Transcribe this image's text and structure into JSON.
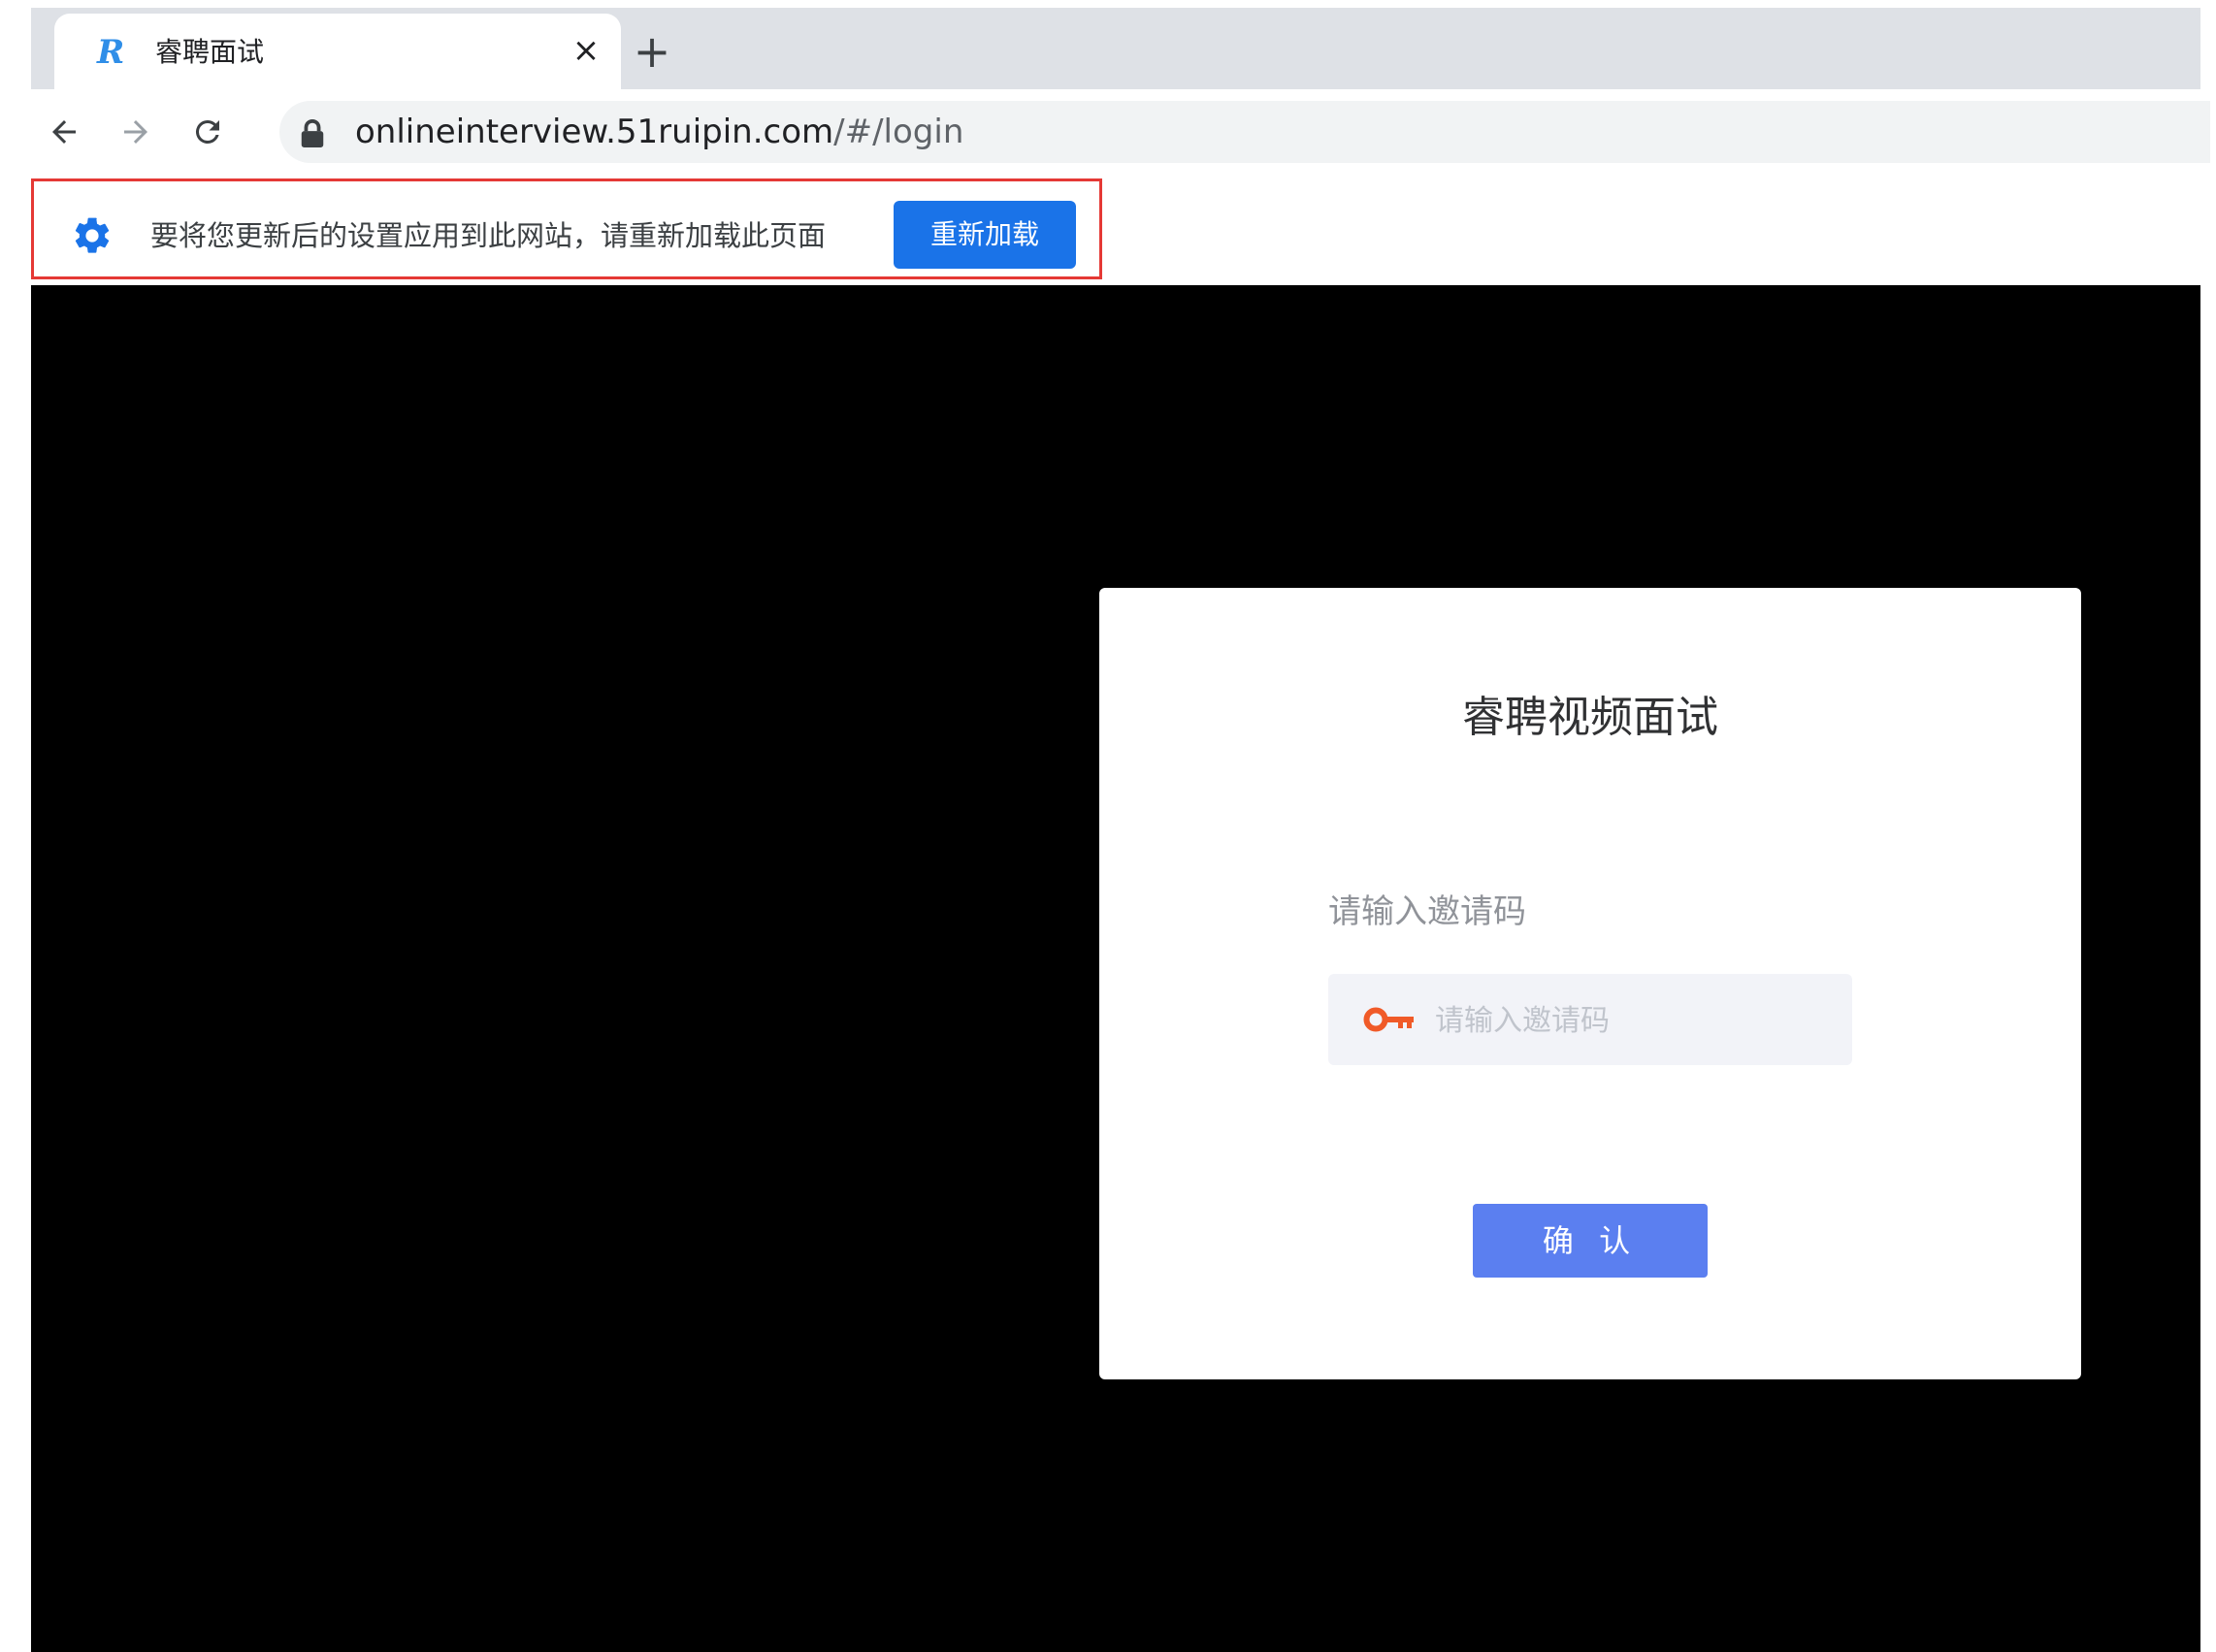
{
  "tab": {
    "title": "睿聘面试",
    "close_glyph": "×",
    "favicon_glyph": "R"
  },
  "new_tab_glyph": "+",
  "toolbar": {
    "url_host": "onlineinterview.51ruipin.com",
    "url_path": "/#/login"
  },
  "infobar": {
    "message": "要将您更新后的设置应用到此网站，请重新加载此页面",
    "reload_label": "重新加载",
    "highlight_color": "#e53935"
  },
  "login": {
    "title": "睿聘视频面试",
    "code_label": "请输入邀请码",
    "code_placeholder": "请输入邀请码",
    "code_value": "",
    "confirm_label": "确 认"
  },
  "colors": {
    "accent": "#5b7ff0",
    "reload_button": "#1a73e8",
    "key_icon": "#f05a28",
    "page_background": "#000000"
  }
}
